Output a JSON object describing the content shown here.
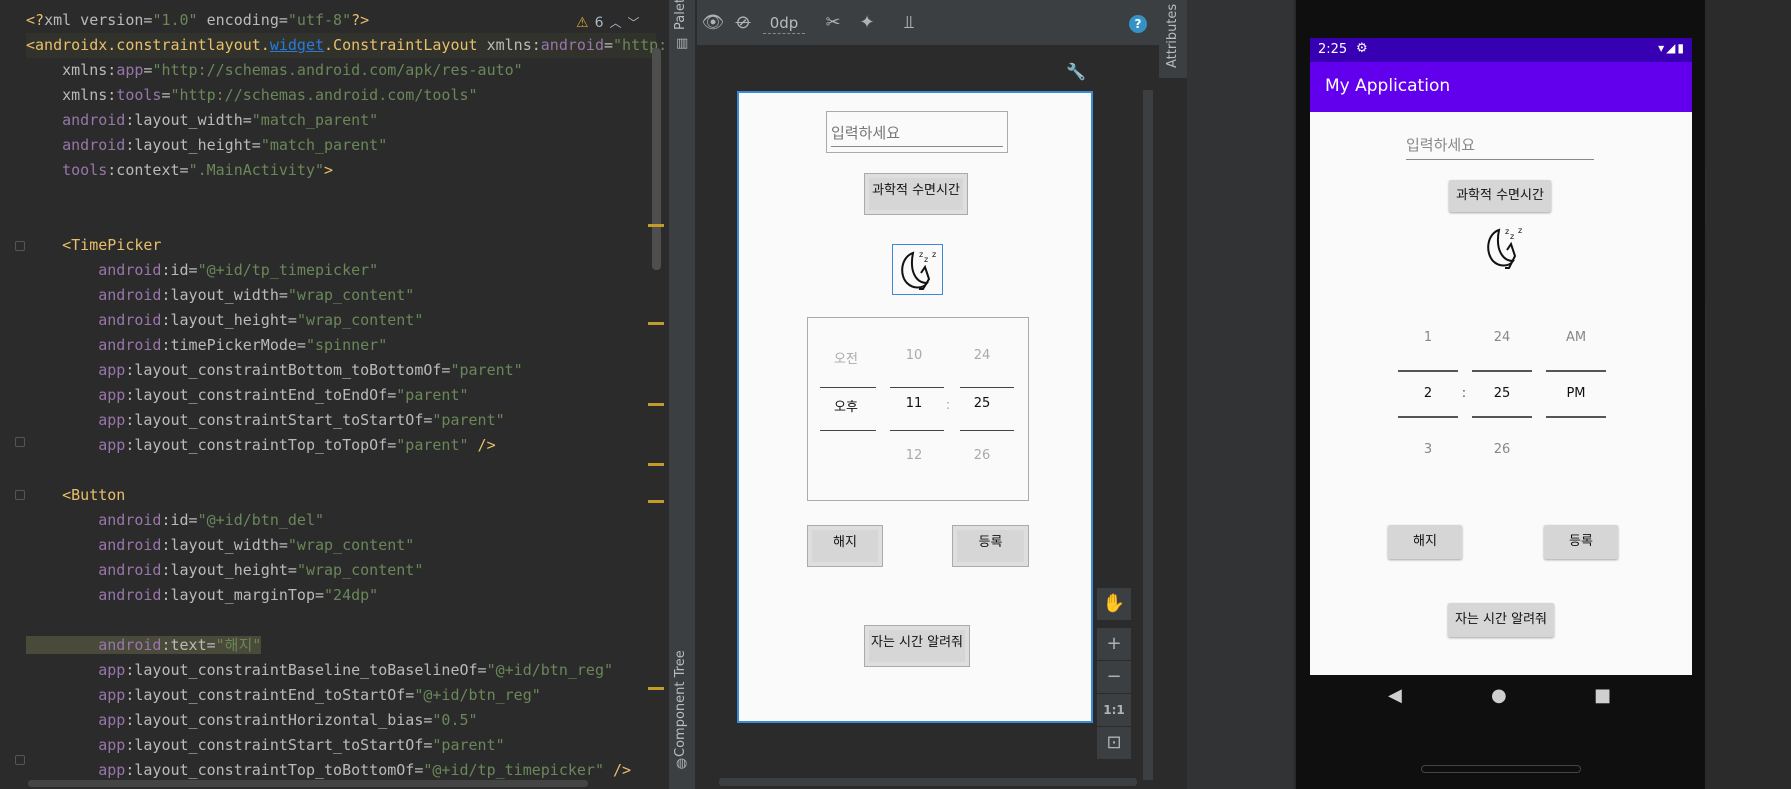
{
  "editor": {
    "warning_count": "6",
    "lines": [
      [
        {
          "c": "tg",
          "t": "<?"
        },
        {
          "c": "at",
          "t": "xml version="
        },
        {
          "c": "av",
          "t": "\"1.0\""
        },
        {
          "c": "at",
          "t": " encoding="
        },
        {
          "c": "av",
          "t": "\"utf-8\""
        },
        {
          "c": "tg",
          "t": "?>"
        }
      ],
      [
        {
          "c": "tg",
          "t": "<androidx.constraintlayout."
        },
        {
          "c": "ul",
          "t": "widget"
        },
        {
          "c": "tg",
          "t": ".ConstraintLayout"
        },
        {
          "c": "at",
          "t": " xmlns:"
        },
        {
          "c": "an",
          "t": "android"
        },
        {
          "c": "at",
          "t": "="
        },
        {
          "c": "av",
          "t": "\"http:"
        }
      ],
      [
        {
          "c": "at",
          "t": "    xmlns:"
        },
        {
          "c": "an",
          "t": "app"
        },
        {
          "c": "at",
          "t": "="
        },
        {
          "c": "av",
          "t": "\"http://schemas.android.com/apk/res-auto\""
        }
      ],
      [
        {
          "c": "at",
          "t": "    xmlns:"
        },
        {
          "c": "an",
          "t": "tools"
        },
        {
          "c": "at",
          "t": "="
        },
        {
          "c": "av",
          "t": "\"http://schemas.android.com/tools\""
        }
      ],
      [
        {
          "c": "an",
          "t": "    android"
        },
        {
          "c": "at",
          "t": ":layout_width="
        },
        {
          "c": "av",
          "t": "\"match_parent\""
        }
      ],
      [
        {
          "c": "an",
          "t": "    android"
        },
        {
          "c": "at",
          "t": ":layout_height="
        },
        {
          "c": "av",
          "t": "\"match_parent\""
        }
      ],
      [
        {
          "c": "an",
          "t": "    tools"
        },
        {
          "c": "at",
          "t": ":context="
        },
        {
          "c": "av",
          "t": "\".MainActivity\""
        },
        {
          "c": "tg",
          "t": ">"
        }
      ],
      [
        {
          "c": "at",
          "t": ""
        }
      ],
      [
        {
          "c": "at",
          "t": ""
        }
      ],
      [
        {
          "c": "tg",
          "t": "    <TimePicker"
        }
      ],
      [
        {
          "c": "an",
          "t": "        android"
        },
        {
          "c": "at",
          "t": ":id="
        },
        {
          "c": "av",
          "t": "\"@+id/tp_timepicker\""
        }
      ],
      [
        {
          "c": "an",
          "t": "        android"
        },
        {
          "c": "at",
          "t": ":layout_width="
        },
        {
          "c": "av",
          "t": "\"wrap_content\""
        }
      ],
      [
        {
          "c": "an",
          "t": "        android"
        },
        {
          "c": "at",
          "t": ":layout_height="
        },
        {
          "c": "av",
          "t": "\"wrap_content\""
        }
      ],
      [
        {
          "c": "an",
          "t": "        android"
        },
        {
          "c": "at",
          "t": ":timePickerMode="
        },
        {
          "c": "av",
          "t": "\"spinner\""
        }
      ],
      [
        {
          "c": "an",
          "t": "        app"
        },
        {
          "c": "at",
          "t": ":layout_constraintBottom_toBottomOf="
        },
        {
          "c": "av",
          "t": "\"parent\""
        }
      ],
      [
        {
          "c": "an",
          "t": "        app"
        },
        {
          "c": "at",
          "t": ":layout_constraintEnd_toEndOf="
        },
        {
          "c": "av",
          "t": "\"parent\""
        }
      ],
      [
        {
          "c": "an",
          "t": "        app"
        },
        {
          "c": "at",
          "t": ":layout_constraintStart_toStartOf="
        },
        {
          "c": "av",
          "t": "\"parent\""
        }
      ],
      [
        {
          "c": "an",
          "t": "        app"
        },
        {
          "c": "at",
          "t": ":layout_constraintTop_toTopOf="
        },
        {
          "c": "av",
          "t": "\"parent\""
        },
        {
          "c": "tg",
          "t": " />"
        }
      ],
      [
        {
          "c": "at",
          "t": ""
        }
      ],
      [
        {
          "c": "tg",
          "t": "    <Button"
        }
      ],
      [
        {
          "c": "an",
          "t": "        android"
        },
        {
          "c": "at",
          "t": ":id="
        },
        {
          "c": "av",
          "t": "\"@+id/btn_del\""
        }
      ],
      [
        {
          "c": "an",
          "t": "        android"
        },
        {
          "c": "at",
          "t": ":layout_width="
        },
        {
          "c": "av",
          "t": "\"wrap_content\""
        }
      ],
      [
        {
          "c": "an",
          "t": "        android"
        },
        {
          "c": "at",
          "t": ":layout_height="
        },
        {
          "c": "av",
          "t": "\"wrap_content\""
        }
      ],
      [
        {
          "c": "an",
          "t": "        android"
        },
        {
          "c": "at",
          "t": ":layout_marginTop="
        },
        {
          "c": "av",
          "t": "\"24dp\""
        }
      ],
      [
        {
          "c": "at",
          "t": ""
        }
      ],
      [
        {
          "c": "an hl",
          "t": "        android"
        },
        {
          "c": "at hl",
          "t": ":text="
        },
        {
          "c": "av hl",
          "t": "\"해지\""
        }
      ],
      [
        {
          "c": "an",
          "t": "        app"
        },
        {
          "c": "at",
          "t": ":layout_constraintBaseline_toBaselineOf="
        },
        {
          "c": "av",
          "t": "\"@+id/btn_reg\""
        }
      ],
      [
        {
          "c": "an",
          "t": "        app"
        },
        {
          "c": "at",
          "t": ":layout_constraintEnd_toStartOf="
        },
        {
          "c": "av",
          "t": "\"@+id/btn_reg\""
        }
      ],
      [
        {
          "c": "an",
          "t": "        app"
        },
        {
          "c": "at",
          "t": ":layout_constraintHorizontal_bias="
        },
        {
          "c": "av",
          "t": "\"0.5\""
        }
      ],
      [
        {
          "c": "an",
          "t": "        app"
        },
        {
          "c": "at",
          "t": ":layout_constraintStart_toStartOf="
        },
        {
          "c": "av",
          "t": "\"parent\""
        }
      ],
      [
        {
          "c": "an",
          "t": "        app"
        },
        {
          "c": "at",
          "t": ":layout_constraintTop_toBottomOf="
        },
        {
          "c": "av",
          "t": "\"@+id/tp_timepicker\""
        },
        {
          "c": "tg",
          "t": " />"
        }
      ]
    ]
  },
  "side_tabs": {
    "palette": "Palette",
    "component_tree": "Component Tree",
    "attributes": "Attributes"
  },
  "design_toolbar": {
    "margin_value": "0dp"
  },
  "zoom": {
    "one_to_one": "1:1"
  },
  "blueprint": {
    "input_hint": "입력하세요",
    "science_button": "과학적 수면시간",
    "picker": {
      "ampm": [
        "오전",
        "오후",
        ""
      ],
      "hours": [
        "10",
        "11",
        "12"
      ],
      "minutes": [
        "24",
        "25",
        "26"
      ],
      "separator": ":"
    },
    "cancel_button": "해지",
    "register_button": "등록",
    "tell_button": "자는 시간 알려줘"
  },
  "phone": {
    "status_time": "2:25",
    "app_title": "My Application",
    "input_hint": "입력하세요",
    "science_button": "과학적 수면시간",
    "picker": {
      "hours": [
        "1",
        "2",
        "3"
      ],
      "minutes": [
        "24",
        "25",
        "26"
      ],
      "ampm": [
        "AM",
        "PM",
        ""
      ],
      "separator": ":"
    },
    "cancel_button": "해지",
    "register_button": "등록",
    "tell_button": "자는 시간 알려줘"
  },
  "colors": {
    "status_bar": "#3700b3",
    "app_bar": "#6200ee",
    "selection_blue": "#3b8ad8"
  }
}
